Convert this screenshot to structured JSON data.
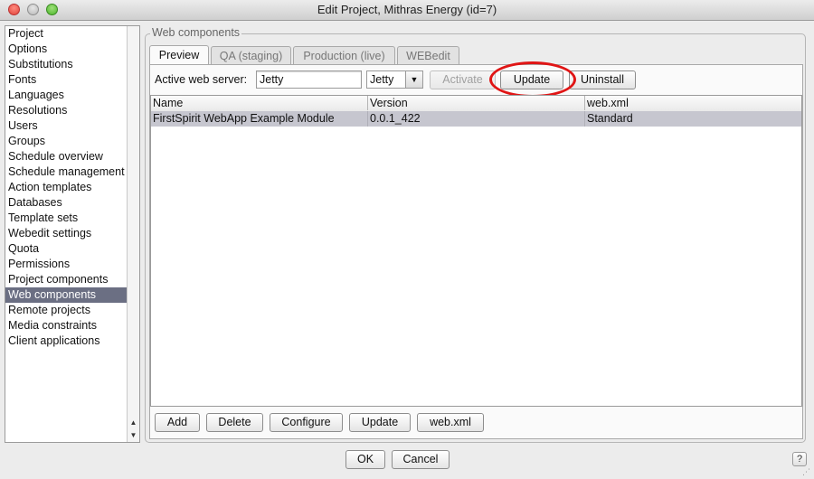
{
  "window": {
    "title": "Edit Project, Mithras Energy (id=7)"
  },
  "sidebar": {
    "items": [
      {
        "label": "Project"
      },
      {
        "label": "Options"
      },
      {
        "label": "Substitutions"
      },
      {
        "label": "Fonts"
      },
      {
        "label": "Languages"
      },
      {
        "label": "Resolutions"
      },
      {
        "label": "Users"
      },
      {
        "label": "Groups"
      },
      {
        "label": "Schedule overview"
      },
      {
        "label": "Schedule management"
      },
      {
        "label": "Action templates"
      },
      {
        "label": "Databases"
      },
      {
        "label": "Template sets"
      },
      {
        "label": "Webedit settings"
      },
      {
        "label": "Quota"
      },
      {
        "label": "Permissions"
      },
      {
        "label": "Project components"
      },
      {
        "label": "Web components"
      },
      {
        "label": "Remote projects"
      },
      {
        "label": "Media constraints"
      },
      {
        "label": "Client applications"
      }
    ],
    "selected": "Web components"
  },
  "group": {
    "title": "Web components"
  },
  "tabs": [
    {
      "label": "Preview"
    },
    {
      "label": "QA (staging)"
    },
    {
      "label": "Production (live)"
    },
    {
      "label": "WEBedit"
    }
  ],
  "server": {
    "label": "Active web server:",
    "value": "Jetty",
    "select_value": "Jetty",
    "activate_label": "Activate",
    "update_label": "Update",
    "uninstall_label": "Uninstall"
  },
  "table": {
    "columns": [
      "Name",
      "Version",
      "web.xml"
    ],
    "rows": [
      [
        "FirstSpirit WebApp Example Module",
        "0.0.1_422",
        "Standard"
      ]
    ]
  },
  "bottom_buttons": {
    "add": "Add",
    "delete": "Delete",
    "configure": "Configure",
    "update": "Update",
    "webxml": "web.xml"
  },
  "dialog": {
    "ok": "OK",
    "cancel": "Cancel",
    "help": "?"
  },
  "colors": {
    "selection": "#6b6f83",
    "row_selected": "#c6c6cf",
    "annotation": "#e01515"
  }
}
